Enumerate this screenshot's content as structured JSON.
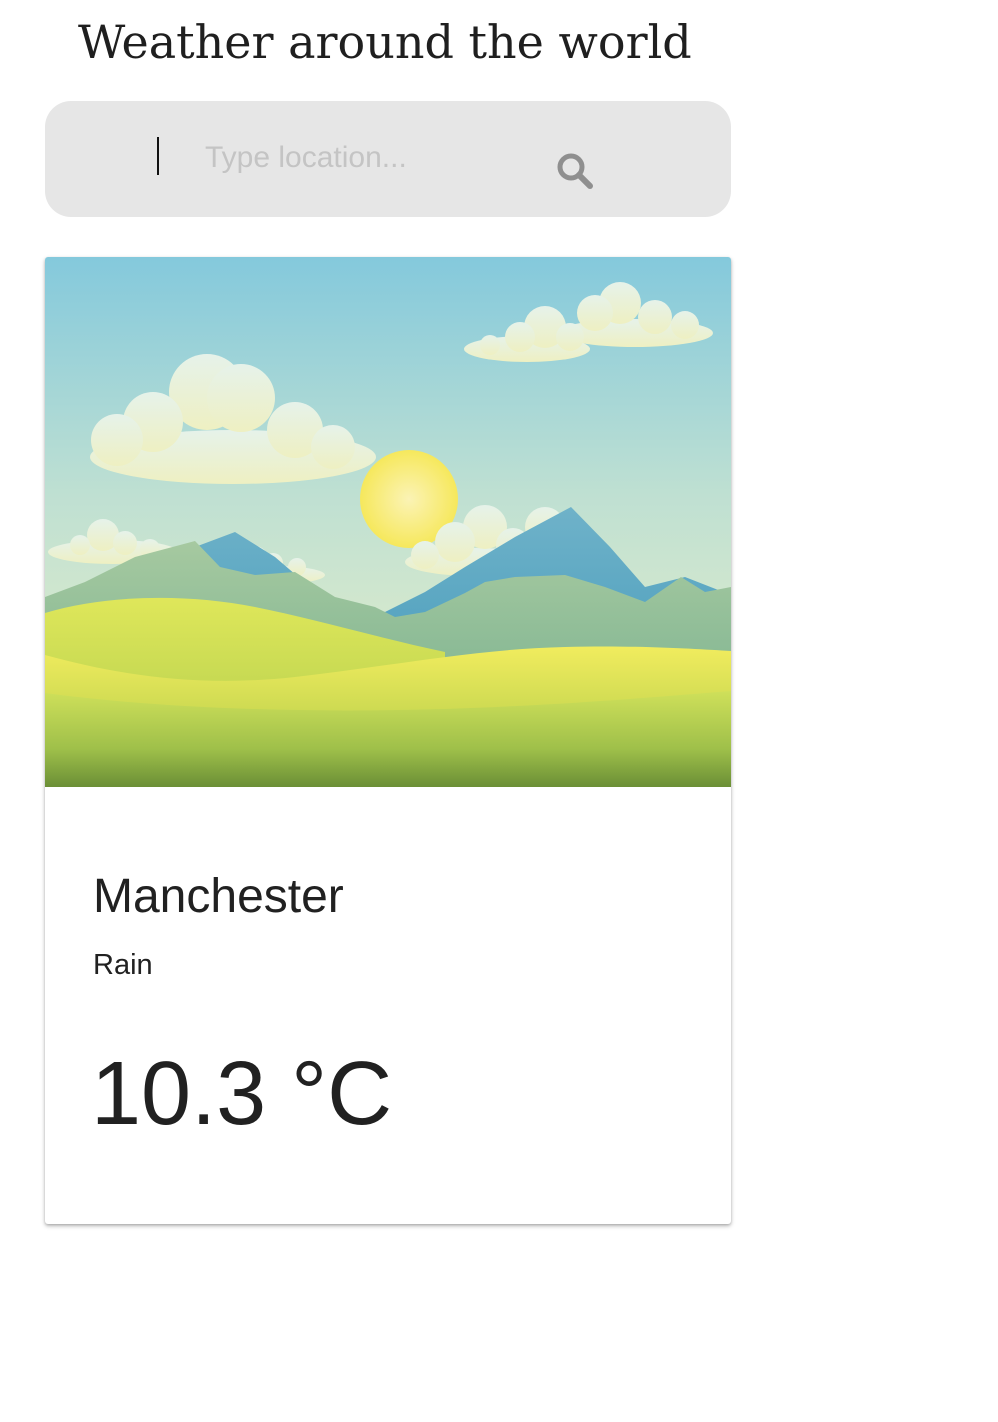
{
  "header": {
    "title": "Weather around the world"
  },
  "search": {
    "placeholder": "Type location...",
    "value": "",
    "icon": "search-icon"
  },
  "weather_card": {
    "image_description_icon": "landscape-illustration",
    "city": "Manchester",
    "condition": "Rain",
    "temperature": "10.3 °C"
  },
  "colors": {
    "search_bg": "#e6e6e6",
    "placeholder": "#c4c4c4",
    "search_icon": "#8f8f8f",
    "text": "#212121"
  }
}
